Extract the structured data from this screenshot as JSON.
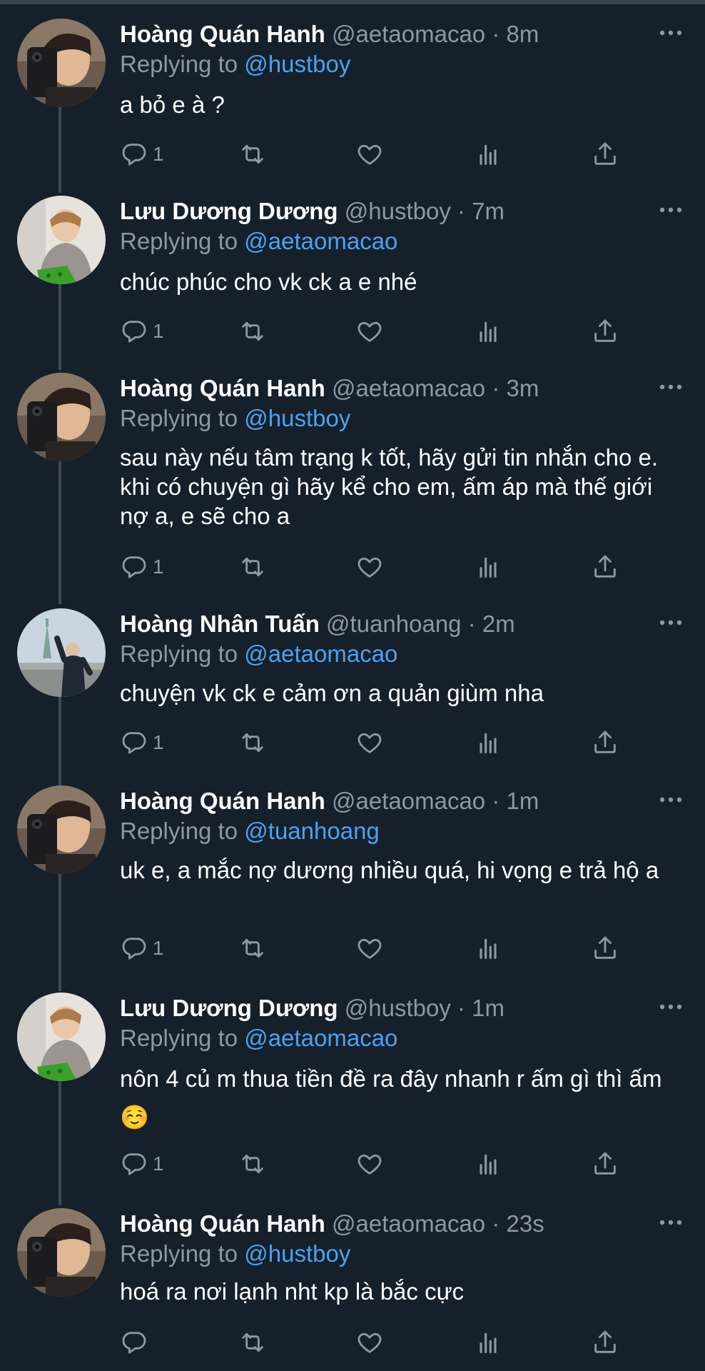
{
  "tweets": [
    {
      "avatar": "hanh-avatar",
      "name": "Hoàng Quán Hanh",
      "handle": "@aetaomacao",
      "dot": "·",
      "time": "8m",
      "replying_prefix": "Replying to",
      "replying_to": "@hustboy",
      "text": "a bỏ e à ?",
      "reply_count": "1"
    },
    {
      "avatar": "duong-avatar",
      "name": "Lưu Dương Dương",
      "handle": "@hustboy",
      "dot": "·",
      "time": "7m",
      "replying_prefix": "Replying to",
      "replying_to": "@aetaomacao",
      "text": "chúc phúc cho vk ck a e nhé",
      "reply_count": "1"
    },
    {
      "avatar": "hanh-avatar",
      "name": "Hoàng Quán Hanh",
      "handle": "@aetaomacao",
      "dot": "·",
      "time": "3m",
      "replying_prefix": "Replying to",
      "replying_to": "@hustboy",
      "text": "sau này nếu tâm trạng k tốt, hãy gửi tin nhắn cho e. khi có chuyện gì hãy kể cho em, ấm áp mà thế giới nợ a, e sẽ cho a",
      "reply_count": "1"
    },
    {
      "avatar": "tuan-avatar",
      "name": "Hoàng Nhân Tuấn",
      "handle": "@tuanhoang",
      "dot": "·",
      "time": "2m",
      "replying_prefix": "Replying to",
      "replying_to": "@aetaomacao",
      "text": "chuyện vk ck e cảm ơn a quản giùm nha",
      "reply_count": "1"
    },
    {
      "avatar": "hanh-avatar",
      "name": "Hoàng Quán Hanh",
      "handle": "@aetaomacao",
      "dot": "·",
      "time": "1m",
      "replying_prefix": "Replying to",
      "replying_to": "@tuanhoang",
      "text": "uk e, a mắc nợ dương nhiều quá, hi vọng e trả hộ a",
      "reply_count": "1"
    },
    {
      "avatar": "duong-avatar",
      "name": "Lưu Dương Dương",
      "handle": "@hustboy",
      "dot": "·",
      "time": "1m",
      "replying_prefix": "Replying to",
      "replying_to": "@aetaomacao",
      "text": "nôn 4 củ m thua tiền đề ra đây nhanh r ấm gì thì ấm ☺️",
      "reply_count": "1"
    },
    {
      "avatar": "hanh-avatar",
      "name": "Hoàng Quán Hanh",
      "handle": "@aetaomacao",
      "dot": "·",
      "time": "23s",
      "replying_prefix": "Replying to",
      "replying_to": "@hustboy",
      "text": "hoá ra nơi lạnh nht kp là bắc cực",
      "reply_count": ""
    }
  ],
  "colors": {
    "background": "#15202b",
    "text": "#ffffff",
    "muted": "#8b98a5",
    "mention": "#4aa3ef",
    "thread_line": "#3d4b56"
  },
  "icons": [
    "reply-icon",
    "retweet-icon",
    "like-icon",
    "analytics-icon",
    "share-icon",
    "more-icon"
  ]
}
